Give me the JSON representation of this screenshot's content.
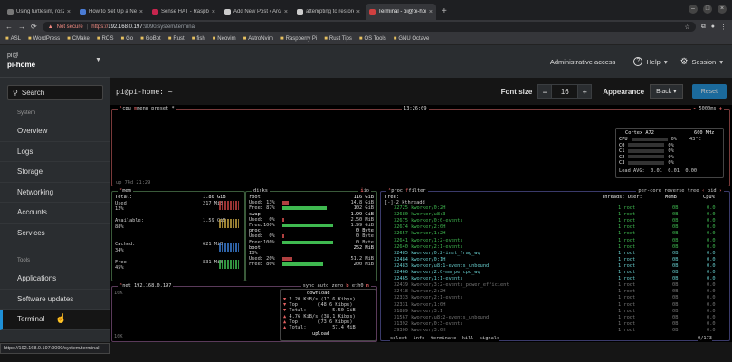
{
  "browser": {
    "tabs": [
      {
        "label": "Using turtlesim, ros2, and",
        "color": "#777777"
      },
      {
        "label": "How to Set Up a Network",
        "color": "#4a7bd4"
      },
      {
        "label": "Sense HAT - Raspberry Pi",
        "color": "#c7254e"
      },
      {
        "label": "Add New Post ‹ Arcane",
        "color": "#cccccc"
      },
      {
        "label": "attempting to restore a",
        "color": "#cccccc"
      },
      {
        "label": "Terminal - pi@pi-home",
        "color": "#d04040"
      }
    ],
    "new_tab": "+",
    "address": {
      "not_secure": "Not secure",
      "scheme": "https://",
      "host": "192.168.0.197",
      "path": ":9090/system/terminal"
    },
    "bookmarks": [
      "ASL",
      "WordPress",
      "CMake",
      "ROS",
      "Go",
      "GoBot",
      "Rust",
      "fish",
      "Neovim",
      "AstroNvim",
      "Raspberry Pi",
      "Rust Tips",
      "OS Tools",
      "GNU Octave"
    ],
    "status_url": "https://192.168.0.197:9090/system/terminal"
  },
  "sidebar": {
    "user": "pi@",
    "host": "pi-home",
    "search_placeholder": "Search",
    "section_system": "System",
    "items_system": [
      "Overview",
      "Logs",
      "Storage",
      "Networking",
      "Accounts",
      "Services"
    ],
    "section_tools": "Tools",
    "items_tools": [
      "Applications",
      "Software updates",
      "Terminal"
    ]
  },
  "header": {
    "admin": "Administrative access",
    "help": "Help",
    "session": "Session"
  },
  "terminal": {
    "title": "pi@pi-home: ~",
    "font_size_label": "Font size",
    "font_size": "16",
    "appearance_label": "Appearance",
    "appearance": "Black",
    "reset": "Reset"
  },
  "btop": {
    "cpu_title": "cpu",
    "menu": "menu",
    "preset": "preset *",
    "clock": "13:26:09",
    "refresh": "5000ms",
    "cpu_model": "Cortex A72",
    "cpu_freq": "600 MHz",
    "cpu_rows": [
      {
        "label": "CPU",
        "pct": "0%",
        "temp": "43°C"
      },
      {
        "label": "C0",
        "pct": "0%"
      },
      {
        "label": "C1",
        "pct": "0%"
      },
      {
        "label": "C2",
        "pct": "0%"
      },
      {
        "label": "C3",
        "pct": "0%"
      }
    ],
    "load_avg": "Load AVG:  0.01  0.01  0.00",
    "uptime": "up 74d 21:29",
    "mem": {
      "total": [
        "Total:",
        "1.80 GiB"
      ],
      "used": [
        "Used:",
        "217 MiB"
      ],
      "used_pct": "12%",
      "available": [
        "Available:",
        "1.59 GiB"
      ],
      "available_pct": "88%",
      "cached": [
        "Cached:",
        "621 MiB"
      ],
      "cached_pct": "34%",
      "free": [
        "Free:",
        "831 MiB"
      ],
      "free_pct": "45%"
    },
    "disks": {
      "title": "disks",
      "io": "io",
      "root": [
        "root",
        "116 GiB"
      ],
      "root_used": [
        "Used: 13%",
        "14.8 GiB"
      ],
      "root_free": [
        "Free: 87%",
        "102 GiB"
      ],
      "swap": [
        "swap",
        "1.99 GiB"
      ],
      "swap_used": [
        "Used:  0%",
        "2.50 MiB"
      ],
      "swap_free": [
        "Free:100%",
        "1.99 GiB"
      ],
      "proc": [
        "proc",
        "0 Byte"
      ],
      "proc_used": [
        "Used:  0%",
        "0 Byte"
      ],
      "proc_free": [
        "Free:100%",
        "0 Byte"
      ],
      "boot": [
        "boot",
        "252 MiB"
      ],
      "boot_io": "IO%",
      "boot_used": [
        "Used: 20%",
        "51.2 MiB"
      ],
      "boot_free": [
        "Free: 80%",
        "200 MiB"
      ]
    },
    "net": {
      "title": "net",
      "ip": "192.168.0.197",
      "opts": "sync auto zero",
      "iface": "eth0",
      "scale_top": "10K",
      "scale_bottom": "10K",
      "download": "download",
      "dl_rate": "2.20 KiB/s (17.6 Kibps)",
      "dl_top": "Top:      (48.6 Kibps)",
      "dl_total": "Total:         5.50 GiB",
      "upload": "upload",
      "ul_rate": "4.76 KiB/s (38.1 Kibps)",
      "ul_top": "Top:      (73.6 Kibps)",
      "ul_total": "Total:         57.4 MiB"
    },
    "proc": {
      "title": "proc",
      "filter": "filter",
      "opts": "per-core reverse tree",
      "sort": "pid",
      "tree_header": "Tree:",
      "threads_header": "Threads: User:",
      "mem_header": "MemB",
      "cpu_header": "Cpu%",
      "root_line": "[-]-2 kthreadd",
      "rows": [
        [
          "32725 kworker/0:2H",
          "1 root",
          "0B",
          "0.0"
        ],
        [
          "32680 kworker/u8:3",
          "1 root",
          "0B",
          "0.0"
        ],
        [
          "32675 kworker/0:0-events",
          "1 root",
          "0B",
          "0.0"
        ],
        [
          "32674 kworker/2:0H",
          "1 root",
          "0B",
          "0.0"
        ],
        [
          "32657 kworker/1:2H",
          "1 root",
          "0B",
          "0.0"
        ],
        [
          "32641 kworker/1:2-events",
          "1 root",
          "0B",
          "0.0"
        ],
        [
          "32640 kworker/2:1-events",
          "1 root",
          "0B",
          "0.0"
        ],
        [
          "32485 kworker/0:2-inet_frag_wq",
          "1 root",
          "0B",
          "0.0"
        ],
        [
          "32484 kworker/0:1H",
          "1 root",
          "0B",
          "0.0"
        ],
        [
          "32483 kworker/u8:1-events_unbound",
          "1 root",
          "0B",
          "0.0"
        ],
        [
          "32466 kworker/2:0-mm_percpu_wq",
          "1 root",
          "0B",
          "0.0"
        ],
        [
          "32465 kworker/1:1-events",
          "1 root",
          "0B",
          "0.0"
        ],
        [
          "32439 kworker/3:2-events_power_efficient",
          "1 root",
          "0B",
          "0.0"
        ],
        [
          "32418 kworker/2:2H",
          "1 root",
          "0B",
          "0.0"
        ],
        [
          "32333 kworker/2:1-events",
          "1 root",
          "0B",
          "0.0"
        ],
        [
          "32331 kworker/1:0H",
          "1 root",
          "0B",
          "0.0"
        ],
        [
          "31889 kworker/3:1",
          "1 root",
          "0B",
          "0.0"
        ],
        [
          "31567 kworker/u8:2-events_unbound",
          "1 root",
          "0B",
          "0.0"
        ],
        [
          "31392 kworker/0:3-events",
          "1 root",
          "0B",
          "0.0"
        ],
        [
          "29300 kworker/3:0H",
          "1 root",
          "0B",
          "0.0"
        ]
      ],
      "footer": "select  info  terminate  kill  signals",
      "count": "0/173"
    }
  }
}
